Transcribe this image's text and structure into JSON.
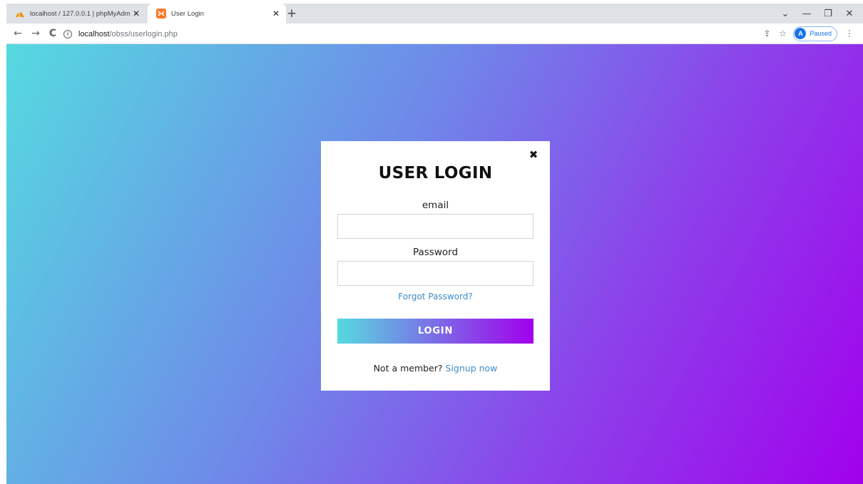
{
  "browser": {
    "tabs": [
      {
        "title": "localhost / 127.0.0.1 | phpMyAdmin",
        "icon": "phpmyadmin-icon",
        "active": false
      },
      {
        "title": "User Login",
        "icon": "xampp-icon",
        "active": true
      }
    ],
    "tab_close_glyph": "✕",
    "new_tab_glyph": "+",
    "window_controls": {
      "dropdown": "⌄",
      "minimize": "—",
      "restore": "❐",
      "close": "✕"
    },
    "nav": {
      "back": "←",
      "forward": "→",
      "reload": "C"
    },
    "url": {
      "host": "localhost",
      "path": "/obss/userlogin.php"
    },
    "profile": {
      "initial": "A",
      "status": "Paused"
    },
    "menu_glyph": "⋮",
    "share_glyph": "⇪",
    "bookmark_glyph": "☆"
  },
  "page": {
    "background_gradient": [
      "#55dae0",
      "#6f87e9",
      "#8b45ea",
      "#a100ec"
    ],
    "login": {
      "title": "USER LOGIN",
      "close_glyph": "✖",
      "email_label": "email",
      "email_value": "",
      "password_label": "Password",
      "password_value": "",
      "forgot_link": "Forgot Password?",
      "button_label": "LOGIN",
      "button_gradient": [
        "#56dae0",
        "#a100ec"
      ],
      "member_prompt": "Not a member?",
      "signup_link": "Signup now",
      "link_color": "#3f8cc8"
    }
  }
}
